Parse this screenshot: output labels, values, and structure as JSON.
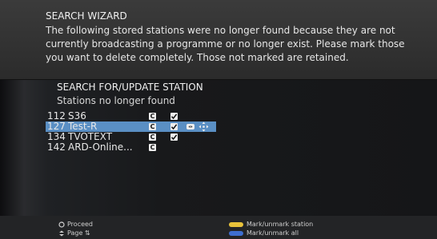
{
  "wizard": {
    "title": "SEARCH WIZARD",
    "message": "The following stored stations were no longer found because they are not currently broadcasting a programme or no longer exist. Please mark those you want to delete completely. Those not marked are retained."
  },
  "panel": {
    "title": "SEARCH FOR/UPDATE STATION",
    "subtitle": "Stations no longer found"
  },
  "stations": [
    {
      "number": "112",
      "name": "S36",
      "badge": "C",
      "checked": true,
      "selected": false
    },
    {
      "number": "127",
      "name": "Test-R",
      "badge": "C",
      "checked": true,
      "selected": true
    },
    {
      "number": "134",
      "name": "TVOTEXT",
      "badge": "C",
      "checked": true,
      "selected": false
    },
    {
      "number": "142",
      "name": "ARD-Online...",
      "badge": "C",
      "checked": false,
      "selected": false
    }
  ],
  "footer": {
    "proceed": "Proceed",
    "page": "Page",
    "page_arrows": "⇅",
    "mark_station": "Mark/unmark station",
    "mark_all": "Mark/unmark all"
  },
  "colors": {
    "selection": "#5a8fc4",
    "yellow_key": "#e8c23a",
    "blue_key": "#3e6fd0"
  }
}
